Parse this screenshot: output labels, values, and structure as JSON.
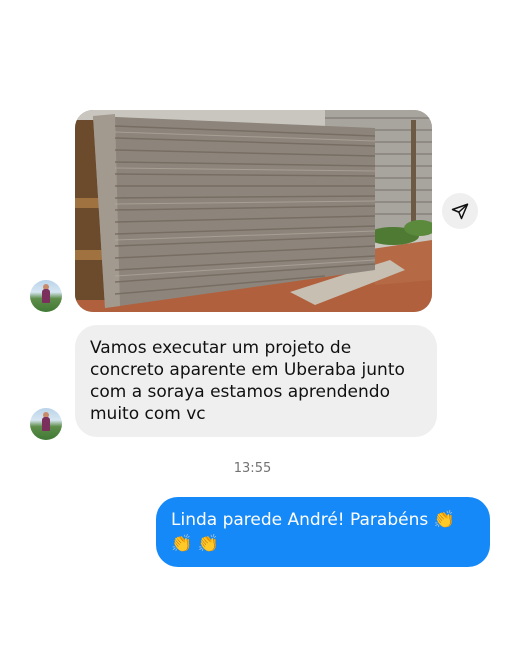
{
  "conversation": {
    "incoming_image": {
      "description_icon": "concrete-wall-photo"
    },
    "share_icon": "paper-plane-icon",
    "incoming_message": {
      "text": "Vamos executar um projeto de concreto aparente em Uberaba junto com a soraya estamos aprendendo muito com vc"
    },
    "timestamp": "13:55",
    "outgoing_message": {
      "text": "Linda parede André! Parabéns 👏 👏 👏"
    }
  },
  "colors": {
    "outgoing_bubble": "#1589f8",
    "incoming_bubble": "#efefef",
    "timestamp": "#737373"
  }
}
